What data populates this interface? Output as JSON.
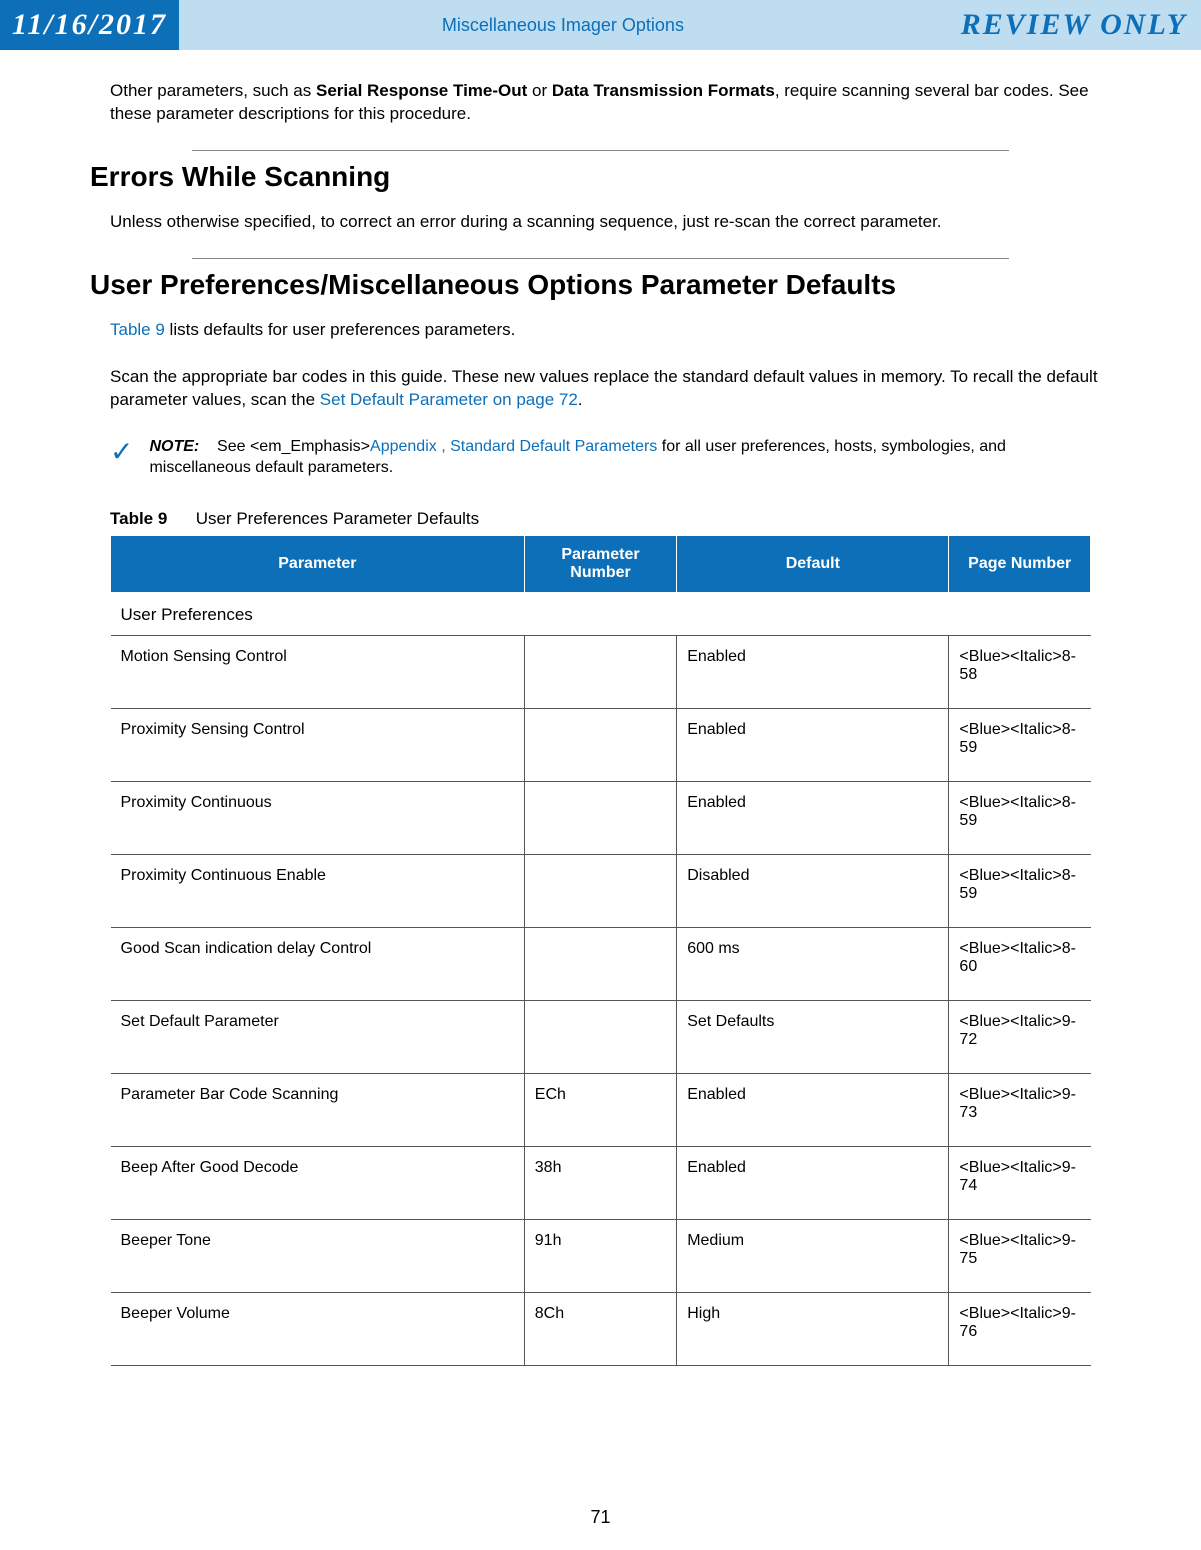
{
  "header": {
    "date": "11/16/2017",
    "title": "Miscellaneous Imager Options",
    "review": "REVIEW ONLY"
  },
  "intro": {
    "prefix": "Other parameters, such as ",
    "bold1": "Serial Response Time-Out",
    "mid": " or ",
    "bold2": "Data Transmission Formats",
    "suffix": ", require scanning several bar codes. See these parameter descriptions for this procedure."
  },
  "sections": {
    "errors": {
      "heading": "Errors While Scanning",
      "text": "Unless otherwise specified, to correct an error during a scanning sequence, just re-scan the correct parameter."
    },
    "prefs": {
      "heading": "User Preferences/Miscellaneous Options Parameter Defaults",
      "p1_link": "Table 9",
      "p1_rest": " lists defaults for user preferences parameters.",
      "p2_pre": "Scan the appropriate bar codes in this guide. These new values replace the standard default values in memory. To recall the default parameter values, scan the ",
      "p2_link": "Set Default Parameter on page 72",
      "p2_post": "."
    }
  },
  "note": {
    "label": "NOTE:",
    "pre": "See <em_Emphasis>",
    "link": "Appendix , Standard Default Parameters",
    "post": " for all user preferences, hosts, symbologies, and miscellaneous default parameters."
  },
  "table": {
    "caption_label": "Table 9",
    "caption_text": "User Preferences Parameter Defaults",
    "headers": {
      "parameter": "Parameter",
      "param_number": "Parameter Number",
      "default": "Default",
      "page_number": "Page Number"
    },
    "section_label": "User Preferences",
    "rows": [
      {
        "param": "Motion Sensing Control",
        "pnum": "",
        "default": "Enabled",
        "page": "<Blue><Italic>8-58"
      },
      {
        "param": "Proximity Sensing Control",
        "pnum": "",
        "default": "Enabled",
        "page": "<Blue><Italic>8-59"
      },
      {
        "param": "Proximity Continuous",
        "pnum": "",
        "default": "Enabled",
        "page": "<Blue><Italic>8-59"
      },
      {
        "param": "Proximity Continuous Enable",
        "pnum": "",
        "default": "Disabled",
        "page": "<Blue><Italic>8-59"
      },
      {
        "param": "Good Scan indication delay Control",
        "pnum": "",
        "default": "600 ms",
        "page": "<Blue><Italic>8-60"
      },
      {
        "param": "Set Default Parameter",
        "pnum": "",
        "default": "Set Defaults",
        "page": "<Blue><Italic>9-72"
      },
      {
        "param": "Parameter Bar Code Scanning",
        "pnum": "ECh",
        "default": "Enabled",
        "page": "<Blue><Italic>9-73"
      },
      {
        "param": "Beep After Good Decode",
        "pnum": "38h",
        "default": "Enabled",
        "page": "<Blue><Italic>9-74"
      },
      {
        "param": "Beeper Tone",
        "pnum": "91h",
        "default": "Medium",
        "page": "<Blue><Italic>9-75"
      },
      {
        "param": "Beeper Volume",
        "pnum": "8Ch",
        "default": "High",
        "page": "<Blue><Italic>9-76"
      }
    ]
  },
  "page_number": "71"
}
